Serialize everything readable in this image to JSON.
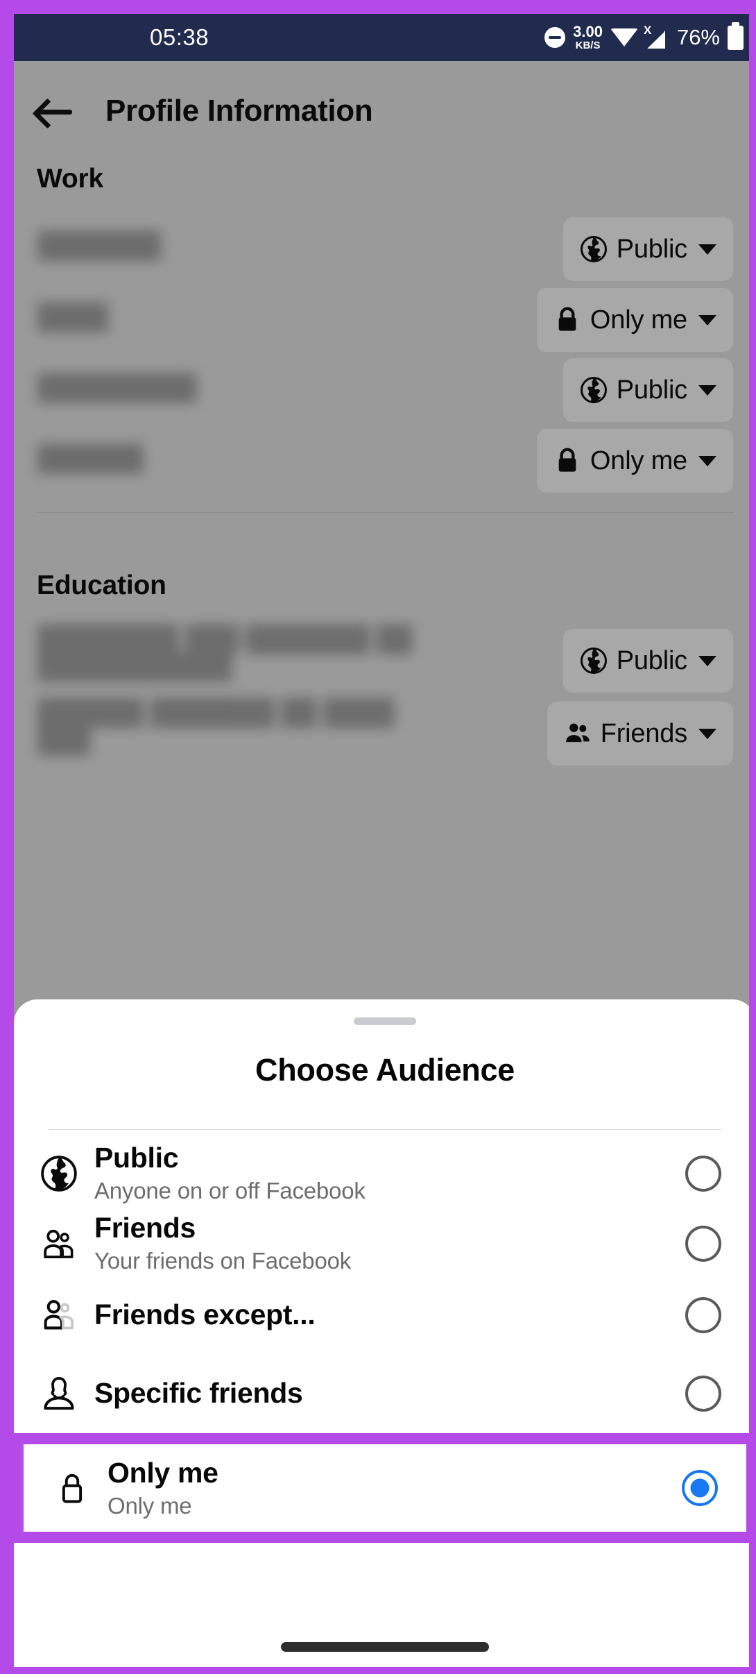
{
  "status_bar": {
    "time": "05:38",
    "dnd_icon": "do-not-disturb-icon",
    "net_speed_value": "3.00",
    "net_speed_unit": "KB/S",
    "wifi_icon": "wifi-icon",
    "signal_icon": "mobile-signal-no-service-icon",
    "signal_badge": "X",
    "battery_percent": "76%",
    "battery_icon": "battery-icon",
    "background_color": "#212b4d"
  },
  "frame": {
    "highlight_color": "#b44ae8"
  },
  "app": {
    "back_icon": "back-arrow-icon",
    "title": "Profile Information",
    "sections": [
      {
        "heading": "Work",
        "rows": [
          {
            "label": "███████",
            "privacy": "Public",
            "icon": "globe-icon"
          },
          {
            "label": "████",
            "privacy": "Only me",
            "icon": "lock-icon"
          },
          {
            "label": "█████████",
            "privacy": "Public",
            "icon": "globe-icon"
          },
          {
            "label": "██████",
            "privacy": "Only me",
            "icon": "lock-icon"
          }
        ]
      },
      {
        "heading": "Education",
        "rows": [
          {
            "label": "████████ ███ ███████ ██\n███████████",
            "privacy": "Public",
            "icon": "globe-icon"
          },
          {
            "label": "██████ ███████ ██ ████\n███",
            "privacy": "Friends",
            "icon": "friends-icon"
          }
        ]
      }
    ]
  },
  "sheet": {
    "drag_handle": "drag-handle",
    "title": "Choose Audience",
    "options": [
      {
        "id": "public",
        "icon": "globe-icon",
        "title": "Public",
        "subtitle": "Anyone on or off Facebook",
        "selected": false
      },
      {
        "id": "friends",
        "icon": "friends-icon",
        "title": "Friends",
        "subtitle": "Your friends on Facebook",
        "selected": false
      },
      {
        "id": "friends-except",
        "icon": "friends-except-icon",
        "title": "Friends except...",
        "subtitle": "",
        "selected": false
      },
      {
        "id": "specific-friends",
        "icon": "person-icon",
        "title": "Specific friends",
        "subtitle": "",
        "selected": false
      }
    ],
    "highlighted_option": {
      "id": "only-me",
      "icon": "lock-icon",
      "title": "Only me",
      "subtitle": "Only me",
      "selected": true,
      "radio_color": "#1877f2"
    }
  },
  "nav": {
    "pill": "home-gesture-pill"
  }
}
